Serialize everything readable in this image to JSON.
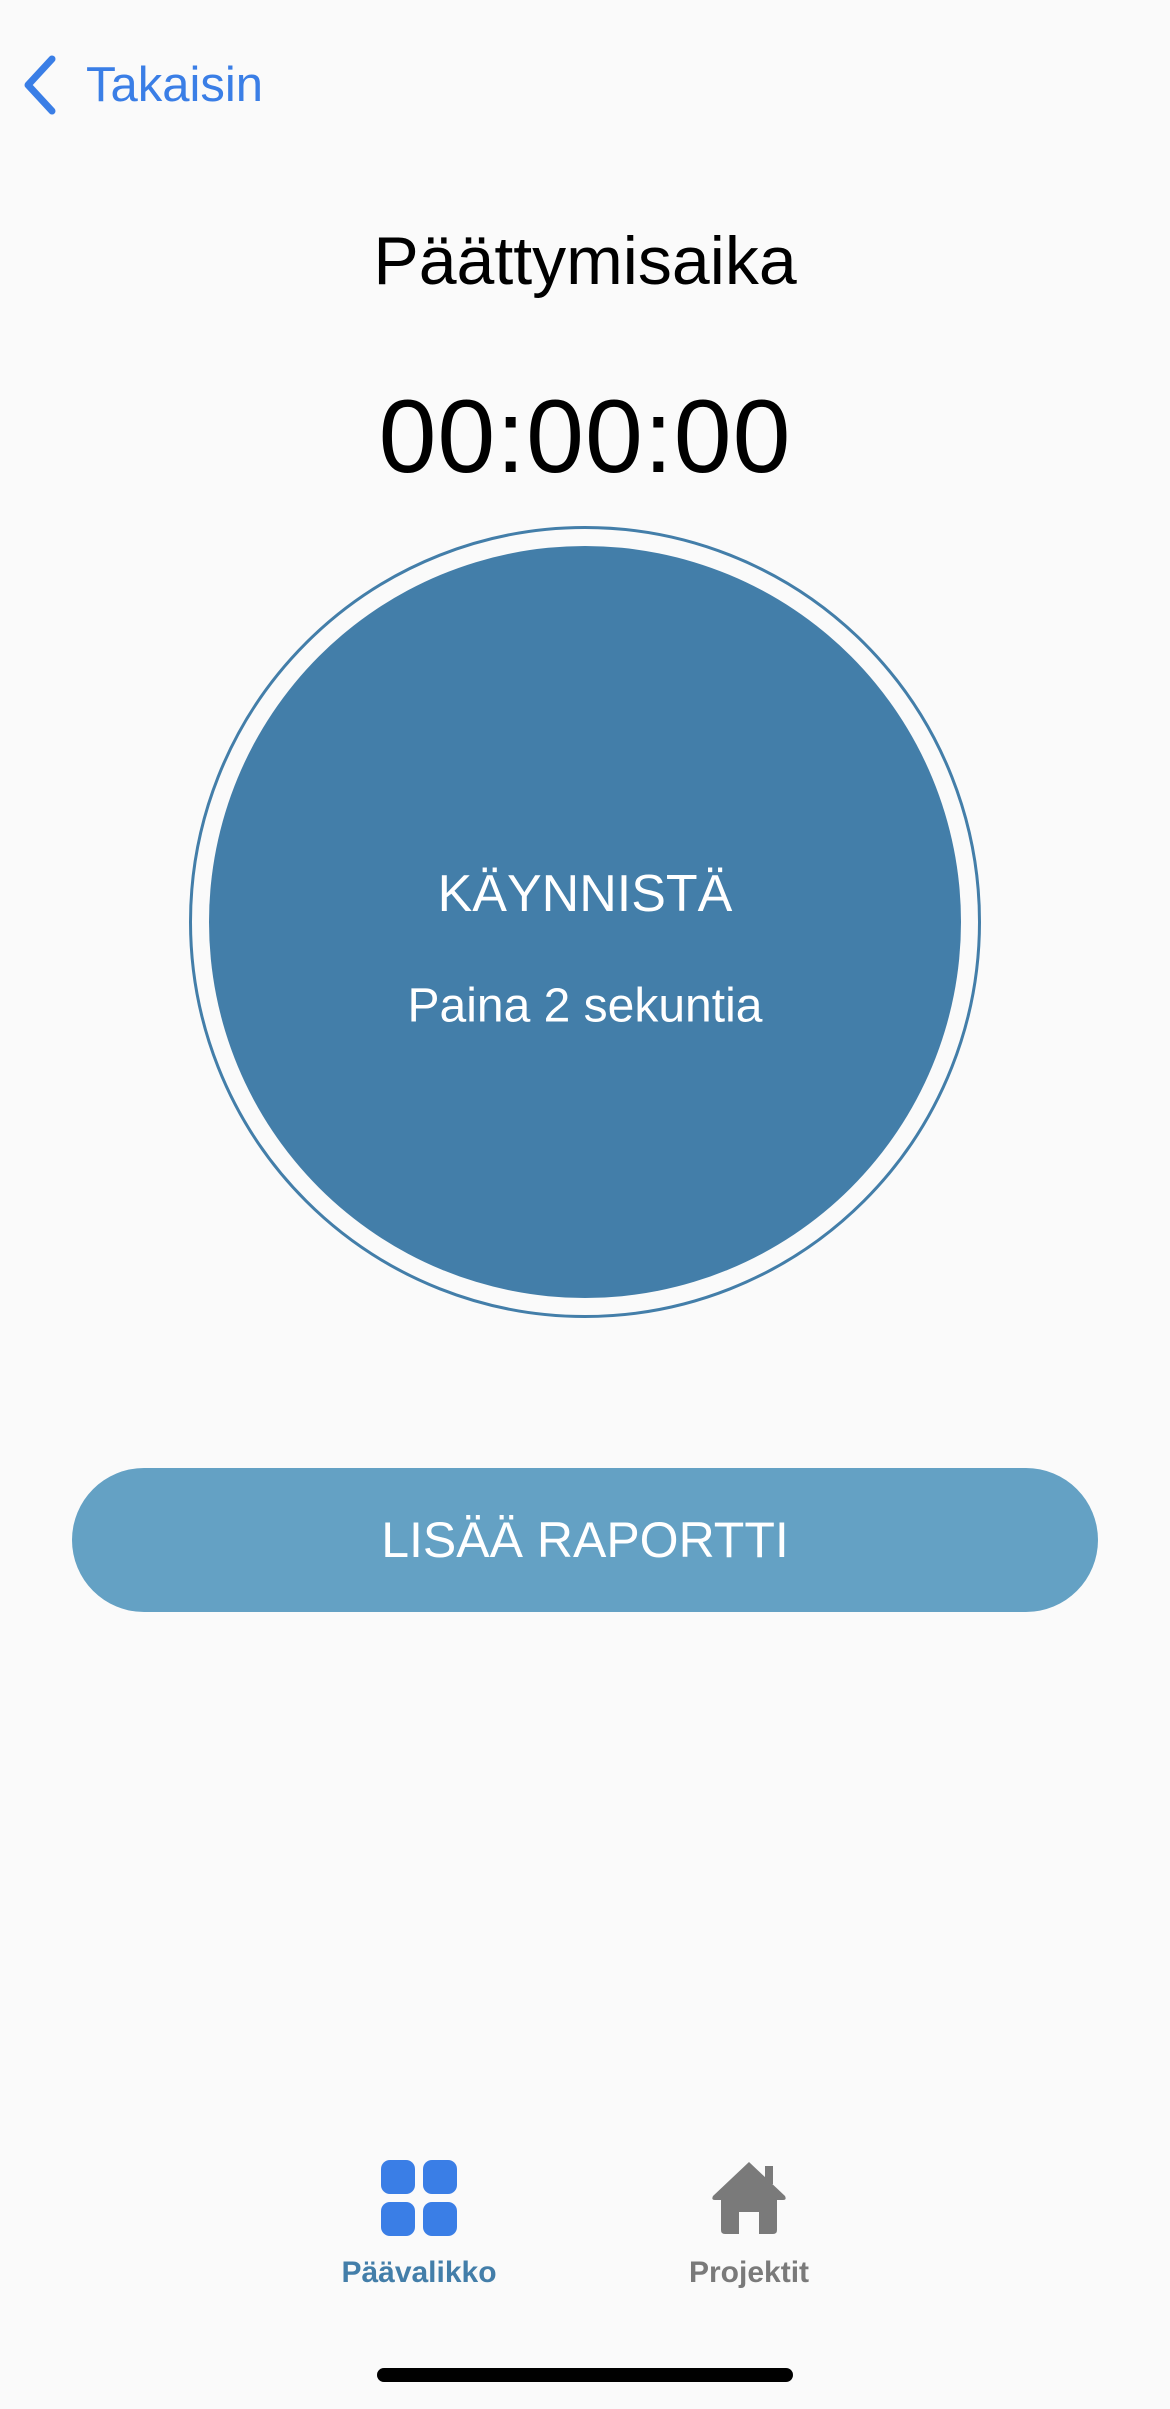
{
  "nav": {
    "back_label": "Takaisin"
  },
  "title": "Päättymisaika",
  "timer": "00:00:00",
  "start": {
    "label": "KÄYNNISTÄ",
    "hint": "Paina 2 sekuntia"
  },
  "add_report_label": "LISÄÄ RAPORTTI",
  "tabs": [
    {
      "label": "Päävalikko",
      "icon": "grid-icon",
      "active": true
    },
    {
      "label": "Projektit",
      "icon": "home-icon",
      "active": false
    }
  ],
  "colors": {
    "accent": "#3a7ee6",
    "primary": "#437ea9",
    "button": "#64a1c4",
    "inactive": "#7a7a7a",
    "background": "#fafafa"
  }
}
